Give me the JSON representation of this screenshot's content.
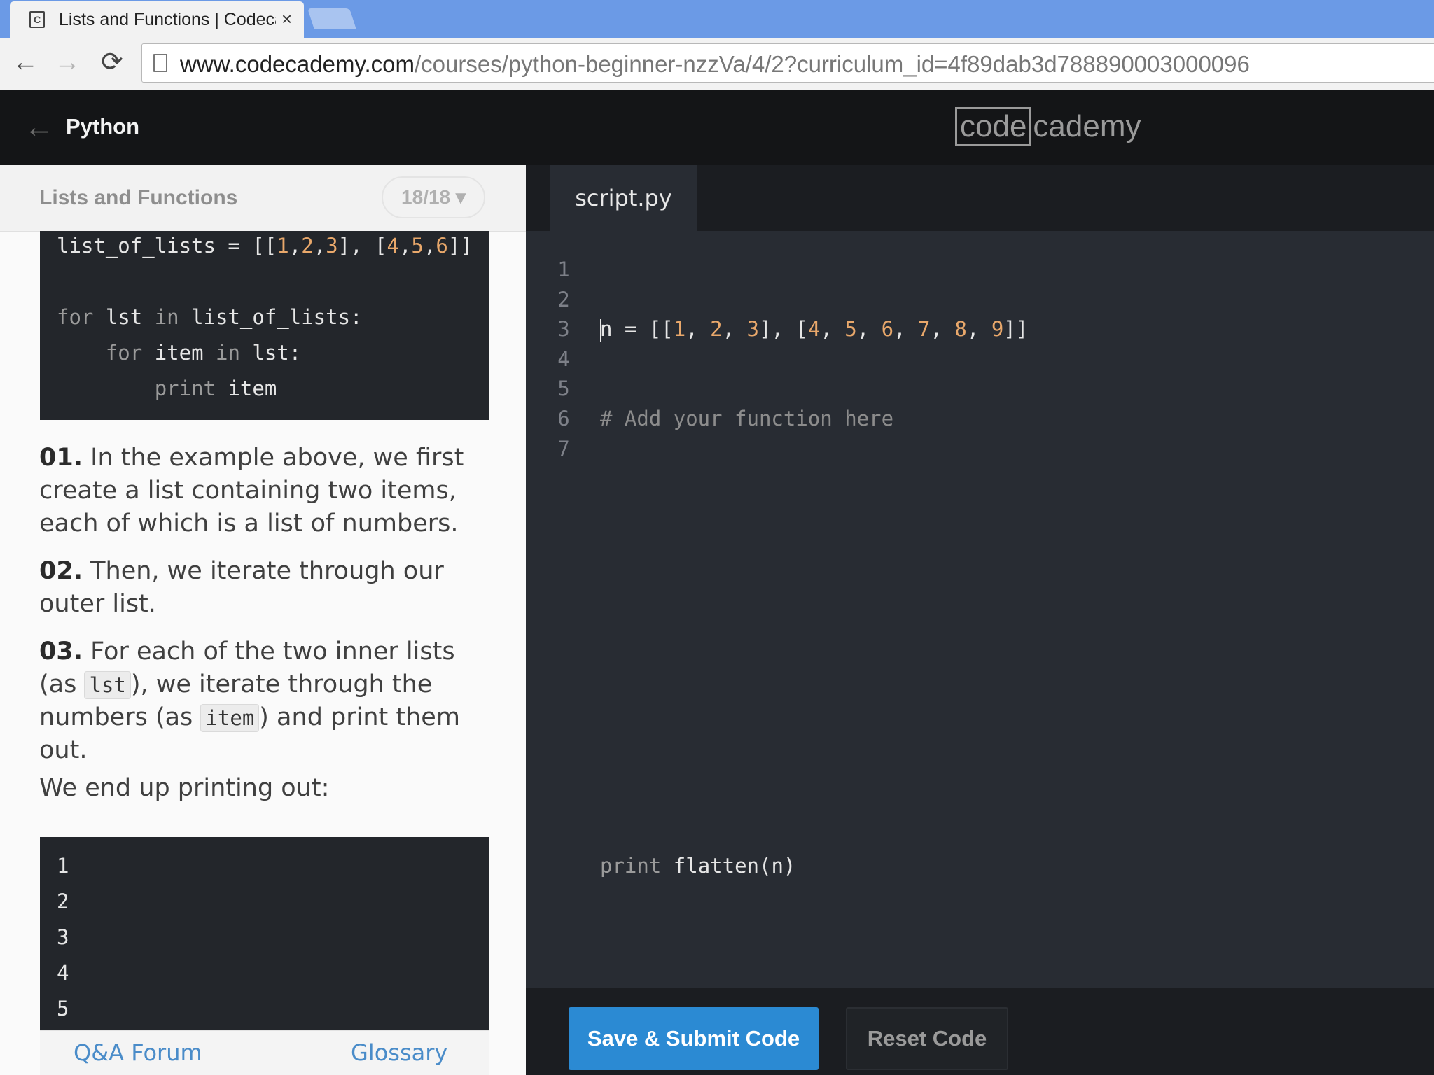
{
  "browser": {
    "tab_title": "Lists and Functions | Codecademy",
    "tab_favicon": "C",
    "tab_close": "×",
    "url_host": "www.codecademy.com",
    "url_path": "/courses/python-beginner-nzzVa/4/2?curriculum_id=4f89dab3d788890003000096",
    "back_icon": "←",
    "forward_icon": "→",
    "reload_icon": "⟳"
  },
  "header": {
    "back_icon": "←",
    "course_title": "Python",
    "logo_box": "code",
    "logo_rest": "cademy"
  },
  "lesson": {
    "title": "Lists and Functions",
    "progress": "18/18 ▾"
  },
  "example_code": {
    "l1_a": "list_of_lists = [[",
    "l1_n1": "1",
    "l1_c1": ",",
    "l1_n2": "2",
    "l1_c2": ",",
    "l1_n3": "3",
    "l1_b": "], [",
    "l1_n4": "4",
    "l1_c3": ",",
    "l1_n5": "5",
    "l1_c4": ",",
    "l1_n6": "6",
    "l1_c": "]]",
    "l3_kw1": "for",
    "l3_a": " lst ",
    "l3_kw2": "in",
    "l3_b": " list_of_lists:",
    "l4_kw1": "for",
    "l4_a": " item ",
    "l4_kw2": "in",
    "l4_b": " lst:",
    "l5_kw": "print",
    "l5_a": " item"
  },
  "instructions": {
    "step1_num": "01.",
    "step1_text": " In the example above, we first create a list containing two items, each of which is a list of numbers.",
    "step2_num": "02.",
    "step2_text": " Then, we iterate through our outer list.",
    "step3_num": "03.",
    "step3_text_a": " For each of the two inner lists (as ",
    "step3_code_a": "lst",
    "step3_text_b": "), we iterate through the numbers (as ",
    "step3_code_b": "item",
    "step3_text_c": ") and print them out.",
    "end_text": "We end up printing out:"
  },
  "output": {
    "lines": [
      "1",
      "2",
      "3",
      "4",
      "5"
    ]
  },
  "footer": {
    "qa_forum": "Q&A Forum",
    "glossary": "Glossary"
  },
  "editor": {
    "filename": "script.py",
    "line_numbers": [
      "1",
      "2",
      "3",
      "4",
      "5",
      "6",
      "7"
    ],
    "code": {
      "l1_a": "n = [[",
      "l1_n1": "1",
      "l1_s1": ", ",
      "l1_n2": "2",
      "l1_s2": ", ",
      "l1_n3": "3",
      "l1_b": "], [",
      "l1_n4": "4",
      "l1_s3": ", ",
      "l1_n5": "5",
      "l1_s4": ", ",
      "l1_n6": "6",
      "l1_s5": ", ",
      "l1_n7": "7",
      "l1_s6": ", ",
      "l1_n8": "8",
      "l1_s7": ", ",
      "l1_n9": "9",
      "l1_c": "]]",
      "l2_comment": "# Add your function here",
      "l7_kw": "print",
      "l7_rest": " flatten(n)"
    }
  },
  "actions": {
    "submit": "Save & Submit Code",
    "reset": "Reset Code"
  },
  "colors": {
    "accent": "#2b8ad3",
    "editor_bg": "#282c33",
    "number": "#e9a86b",
    "link": "#4a8cc9"
  }
}
